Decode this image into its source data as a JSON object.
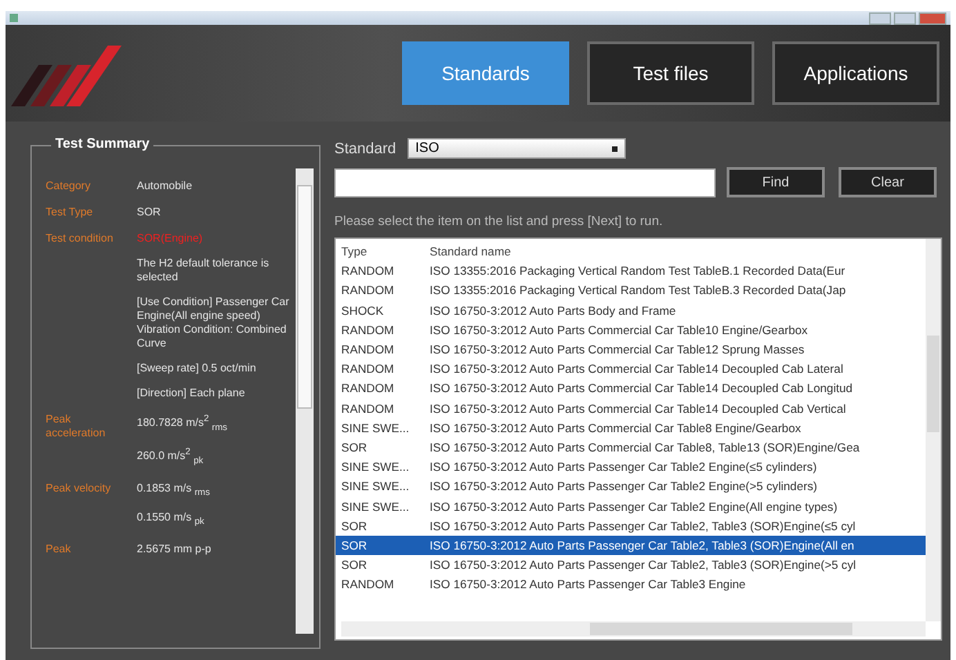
{
  "tabs": [
    {
      "label": "Standards",
      "selected": true
    },
    {
      "label": "Test files",
      "selected": false
    },
    {
      "label": "Applications",
      "selected": false
    }
  ],
  "summary": {
    "title": "Test Summary",
    "rows": [
      {
        "label": "Category",
        "lines": [
          {
            "kind": "text",
            "text": "Automobile"
          }
        ]
      },
      {
        "label": "Test Type",
        "lines": [
          {
            "kind": "text",
            "text": "SOR"
          }
        ]
      },
      {
        "label": "Test condition",
        "lines": [
          {
            "kind": "alert",
            "text": "SOR(Engine)"
          },
          {
            "kind": "text",
            "text": "The H2 default tolerance is selected"
          },
          {
            "kind": "text",
            "text": "[Use Condition] Passenger Car Engine(All engine speed) Vibration Condition: Combined Curve"
          },
          {
            "kind": "text",
            "text": "[Sweep rate] 0.5 oct/min"
          },
          {
            "kind": "text",
            "text": "[Direction] Each plane"
          }
        ]
      },
      {
        "label": "Peak acceleration",
        "lines": [
          {
            "kind": "text",
            "text": "180.7828 m/s$^{2}$ $_{rms}$"
          },
          {
            "kind": "text",
            "text": "260.0 m/s$^{2}$ $_{pk}$"
          }
        ]
      },
      {
        "label": "Peak velocity",
        "lines": [
          {
            "kind": "text",
            "text": "0.1853 m/s $_{rms}$"
          },
          {
            "kind": "text",
            "text": "0.1550 m/s $_{pk}$"
          }
        ]
      },
      {
        "label": "Peak",
        "lines": [
          {
            "kind": "text",
            "text": "2.5675 mm p-p"
          }
        ]
      }
    ]
  },
  "standard": {
    "label": "Standard",
    "value": "ISO"
  },
  "buttons": [
    "Find",
    "Clear"
  ],
  "instruction": "Please select the item on the list and press [Next] to run.",
  "table": {
    "columns": [
      "Type",
      "Standard name"
    ],
    "rows": [
      {
        "type": "RANDOM",
        "name": "ISO 13355:2016 Packaging Vertical Random Test TableB.1 Recorded Data(Eur",
        "selected": false
      },
      {
        "type": "RANDOM",
        "name": "ISO 13355:2016 Packaging Vertical Random Test TableB.3 Recorded Data(Jap",
        "selected": false
      },
      {
        "type": "SHOCK",
        "name": "ISO 16750-3:2012 Auto Parts Body and Frame",
        "selected": false
      },
      {
        "type": "RANDOM",
        "name": "ISO 16750-3:2012 Auto Parts Commercial Car Table10 Engine/Gearbox",
        "selected": false
      },
      {
        "type": "RANDOM",
        "name": "ISO 16750-3:2012 Auto Parts Commercial Car Table12 Sprung Masses",
        "selected": false
      },
      {
        "type": "RANDOM",
        "name": "ISO 16750-3:2012 Auto Parts Commercial Car Table14 Decoupled Cab Lateral",
        "selected": false
      },
      {
        "type": "RANDOM",
        "name": "ISO 16750-3:2012 Auto Parts Commercial Car Table14 Decoupled Cab Longitud",
        "selected": false
      },
      {
        "type": "RANDOM",
        "name": "ISO 16750-3:2012 Auto Parts Commercial Car Table14 Decoupled Cab Vertical",
        "selected": false
      },
      {
        "type": "SINE SWE...",
        "name": "ISO 16750-3:2012 Auto Parts Commercial Car Table8 Engine/Gearbox",
        "selected": false
      },
      {
        "type": "SOR",
        "name": "ISO 16750-3:2012 Auto Parts Commercial Car Table8, Table13 (SOR)Engine/Gea",
        "selected": false
      },
      {
        "type": "SINE SWE...",
        "name": "ISO 16750-3:2012 Auto Parts Passenger Car Table2 Engine(≤5 cylinders)",
        "selected": false
      },
      {
        "type": "SINE SWE...",
        "name": "ISO 16750-3:2012 Auto Parts Passenger Car Table2 Engine(>5 cylinders)",
        "selected": false
      },
      {
        "type": "SINE SWE...",
        "name": "ISO 16750-3:2012 Auto Parts Passenger Car Table2 Engine(All engine types)",
        "selected": false
      },
      {
        "type": "SOR",
        "name": "ISO 16750-3:2012 Auto Parts Passenger Car Table2, Table3 (SOR)Engine(≤5 cyl",
        "selected": false
      },
      {
        "type": "SOR",
        "name": "ISO 16750-3:2012 Auto Parts Passenger Car Table2, Table3 (SOR)Engine(All en",
        "selected": true
      },
      {
        "type": "SOR",
        "name": "ISO 16750-3:2012 Auto Parts Passenger Car Table2, Table3 (SOR)Engine(>5 cyl",
        "selected": false
      },
      {
        "type": "RANDOM",
        "name": "ISO 16750-3:2012 Auto Parts Passenger Car Table3 Engine",
        "selected": false
      }
    ]
  }
}
